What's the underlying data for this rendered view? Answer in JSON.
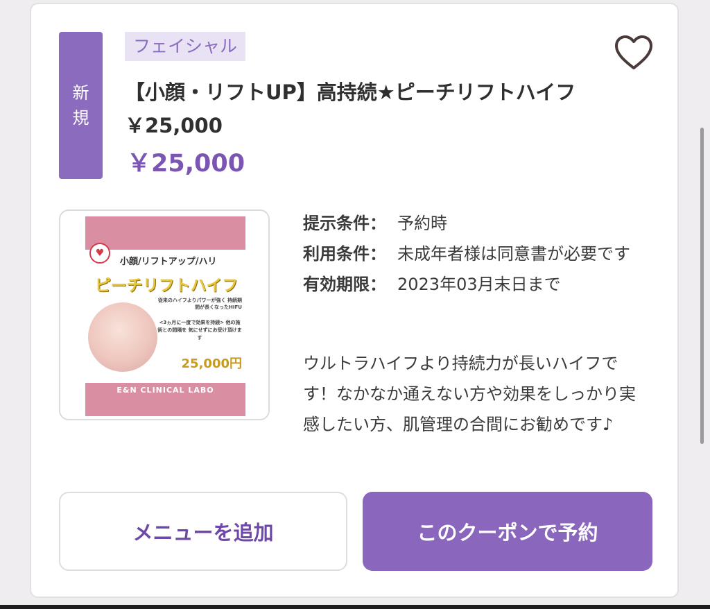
{
  "card": {
    "badge_chars": [
      "新",
      "規"
    ],
    "category": "フェイシャル",
    "title": "【小顔・リフトUP】高持続★ピーチリフトハイフ￥25,000",
    "price": "￥25,000"
  },
  "image": {
    "sub_text": "小顔/リフトアップ/ハリ",
    "headline": "ピーチリフトハイフ",
    "desc_top": "従来のハイフよりパワーが強く 持続期間が長くなったHIFU",
    "desc_mid": "<3ヵ月に一度で効果を持続> 他の施術との間隔を 気にせずにお受け頂けます",
    "price": "25,000円",
    "brand": "E&N CLINICAL LABO"
  },
  "conditions": [
    {
      "key": "提示条件：",
      "value": "予約時"
    },
    {
      "key": "利用条件：",
      "value": "未成年者様は同意書が必要です"
    },
    {
      "key": "有効期限：",
      "value": "2023年03月末日まで"
    }
  ],
  "description": "ウルトラハイフより持続力が長いハイフです！なかなか通えない方や効果をしっかり実感したい方、肌管理の合間にお勧めです♪",
  "buttons": {
    "add_menu": "メニューを追加",
    "reserve": "このクーポンで予約"
  },
  "icons": {
    "favorite": "heart-outline-icon"
  },
  "colors": {
    "accent": "#8a66bd",
    "price": "#7a55b4",
    "category_bg": "#e9e2f4"
  }
}
